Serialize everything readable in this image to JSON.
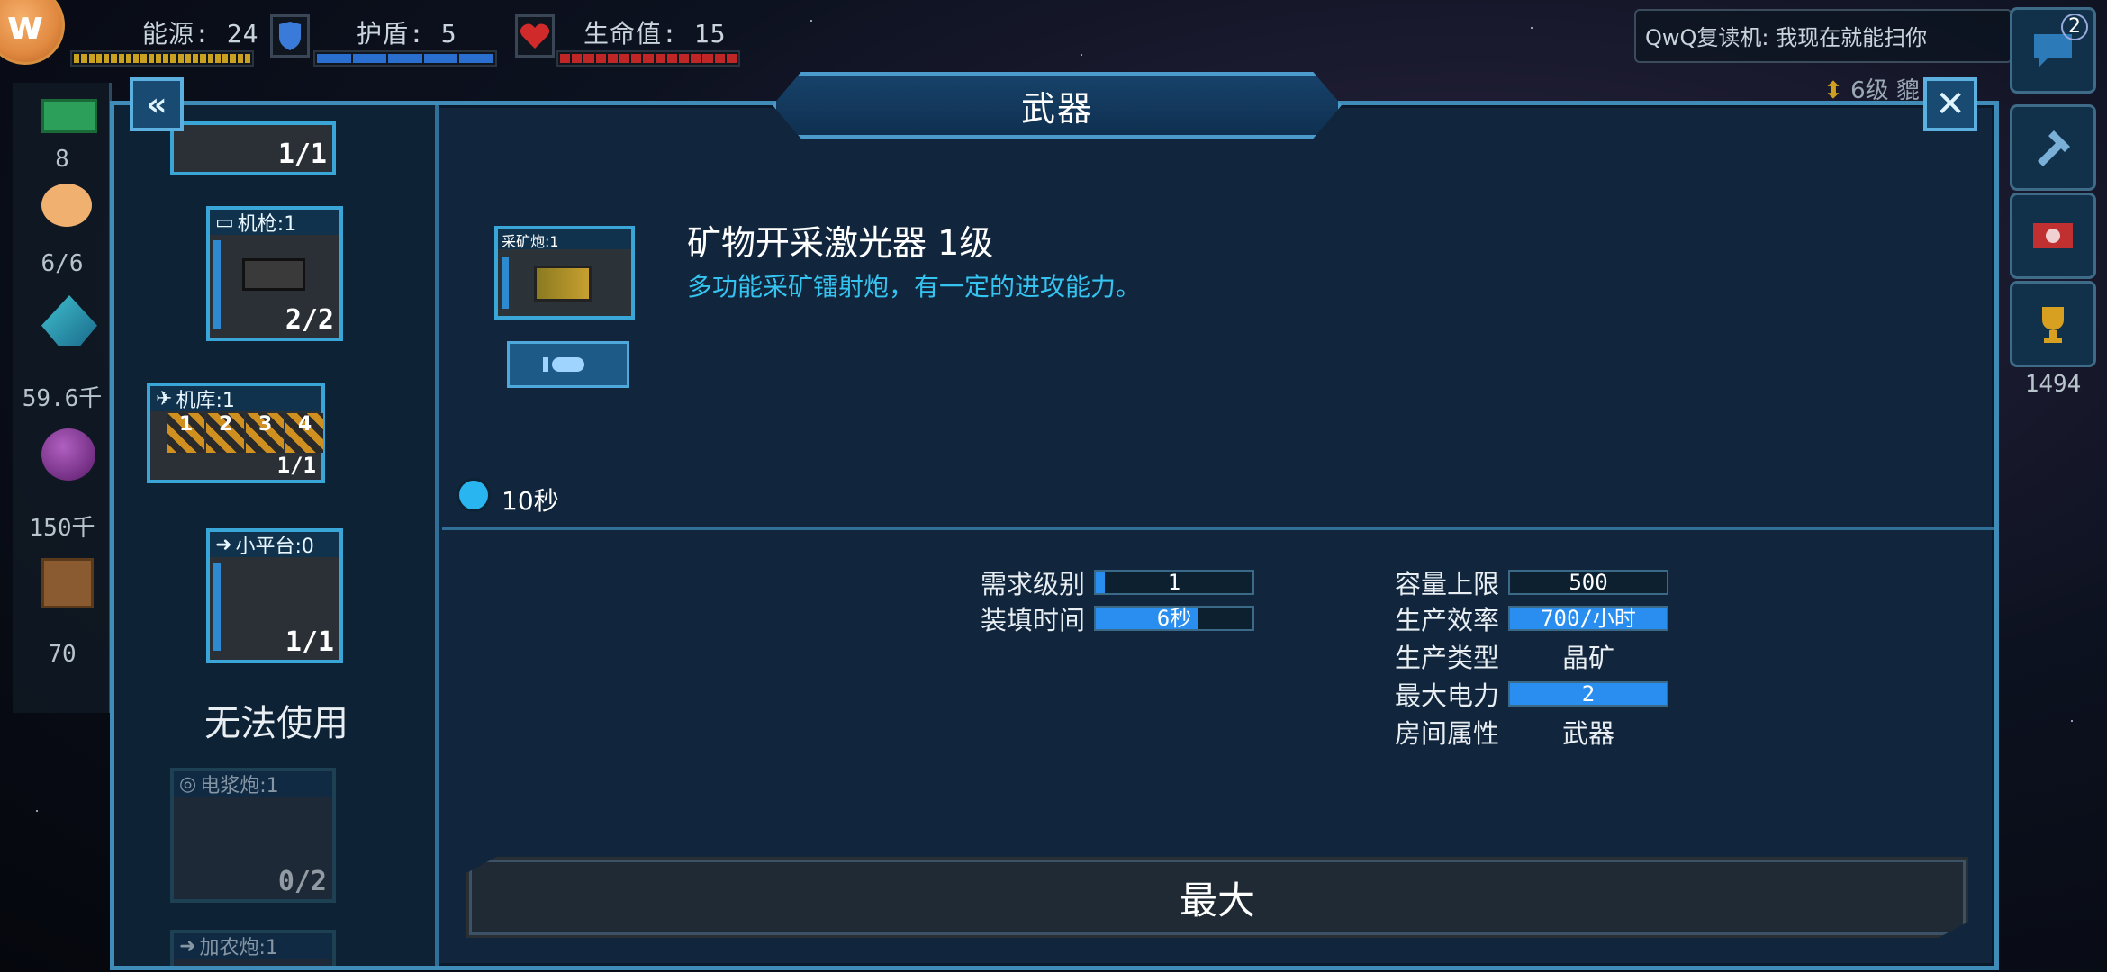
{
  "hud": {
    "energy_label": "能源: 24",
    "shield_label": "护盾: 5",
    "life_label": "生命值: 15",
    "avatar_letter": "w"
  },
  "chat": {
    "message": "QwQ复读机: 我现在就能扫你"
  },
  "rank": {
    "text": "6级 貔"
  },
  "left_rail": {
    "values": [
      "8",
      "6/6",
      "59.6千",
      "150千",
      "70"
    ]
  },
  "right_rail": {
    "chat_badge": "2",
    "trophy_count": "1494"
  },
  "panel": {
    "title": "武器",
    "back_icon": "«",
    "close_icon": "✕"
  },
  "sidebar": {
    "rooms": [
      {
        "label": "",
        "count": "1/1"
      },
      {
        "label": "机枪:1",
        "count": "2/2"
      },
      {
        "label": "机库:1",
        "count": "1/1",
        "bays": [
          "1",
          "2",
          "3",
          "4"
        ]
      },
      {
        "label": "小平台:0",
        "count": "1/1"
      },
      {
        "label": "电浆炮:1",
        "count": "0/2"
      },
      {
        "label": "加农炮:1",
        "count": ""
      }
    ],
    "unusable_text": "无法使用"
  },
  "detail": {
    "thumb_label": "采矿炮:1",
    "name": "矿物开采激光器 1级",
    "description": "多功能采矿镭射炮，有一定的进攻能力。",
    "time": "10秒",
    "stats_left": [
      {
        "key": "需求级别",
        "value": "1",
        "fill": 0.06
      },
      {
        "key": "装填时间",
        "value": "6秒",
        "fill": 0.65
      }
    ],
    "stats_right": [
      {
        "key": "容量上限",
        "value": "500",
        "fill": 0
      },
      {
        "key": "生产效率",
        "value": "700/小时",
        "fill": 1.0
      },
      {
        "key": "生产类型",
        "value": "晶矿"
      },
      {
        "key": "最大电力",
        "value": "2",
        "fill": 1.0
      },
      {
        "key": "房间属性",
        "value": "武器"
      }
    ],
    "max_button": "最大"
  },
  "colors": {
    "accent": "#3aa6d8",
    "panel_bg": "#11263d",
    "desc_text": "#35c3f0",
    "bar_fill": "#2a8ef0"
  }
}
